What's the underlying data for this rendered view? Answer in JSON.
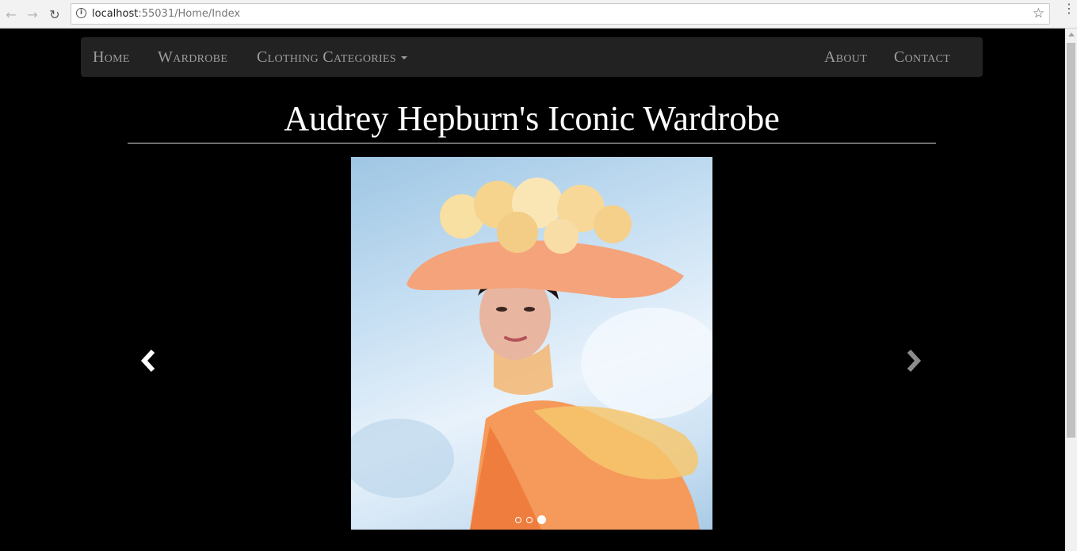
{
  "browser": {
    "url_host": "localhost",
    "url_port": ":55031",
    "url_path": "/Home/Index",
    "back_icon": "back-arrow-icon",
    "forward_icon": "forward-arrow-icon",
    "reload_icon": "reload-icon",
    "bookmark_icon": "star-icon"
  },
  "navbar": {
    "left_items": [
      {
        "label": "Home"
      },
      {
        "label": "Wardrobe"
      },
      {
        "label": "Clothing Categories"
      }
    ],
    "right_items": [
      {
        "label": "About"
      },
      {
        "label": "Contact"
      }
    ]
  },
  "main": {
    "title": "Audrey Hepburn's Iconic Wardrobe"
  },
  "carousel": {
    "image_description": "portrait photo",
    "prev_icon": "chevron-left-icon",
    "next_icon": "chevron-right-icon",
    "slide_count": 3,
    "active_slide": 3
  },
  "colors": {
    "page_bg": "#000000",
    "navbar_bg": "#222222",
    "nav_text": "#9d9d9d",
    "title_text": "#ffffff"
  }
}
